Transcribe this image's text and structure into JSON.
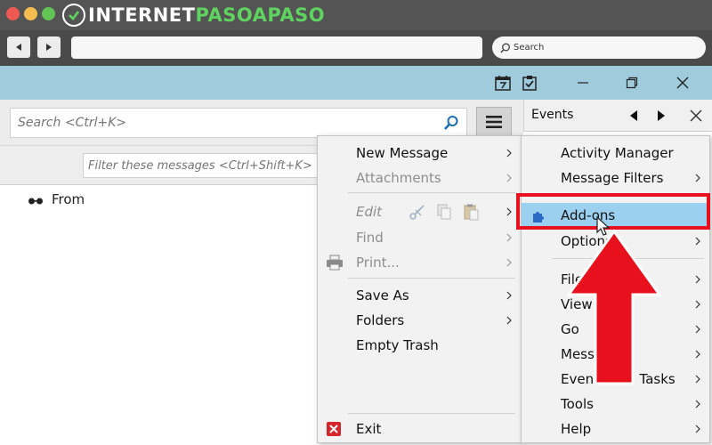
{
  "brand": {
    "logo_prefix": "INTERNET",
    "logo_accent": "PASOAPASO",
    "colors": {
      "accent": "#5fd35f",
      "chrome": "#4f4f4f"
    }
  },
  "browser": {
    "search_placeholder": "Search"
  },
  "app": {
    "titlebar_color": "#9fcbdc",
    "quick_search": {
      "placeholder": "Search <Ctrl+K>"
    },
    "filter": {
      "placeholder": "Filter these messages <Ctrl+Shift+K>"
    },
    "columns": {
      "from": "From"
    },
    "events": {
      "title": "Events"
    }
  },
  "main_menu": {
    "new_message": "New Message",
    "attachments": "Attachments",
    "edit": "Edit",
    "find": "Find",
    "print": "Print...",
    "save_as": "Save As",
    "folders": "Folders",
    "empty_trash": "Empty Trash",
    "exit": "Exit"
  },
  "sub_menu": {
    "activity_manager": "Activity Manager",
    "message_filters": "Message Filters",
    "addons": "Add-ons",
    "options": "Options",
    "file": "File",
    "view": "View",
    "go": "Go",
    "message": "Message",
    "events_tasks": "Events and Tasks",
    "tools": "Tools",
    "help": "Help"
  },
  "icons": {
    "calendar": "calendar-icon",
    "tasks": "tasks-icon",
    "addons": "puzzle-icon",
    "print": "printer-icon",
    "exit": "exit-icon"
  },
  "highlight_color": "#e8101c"
}
